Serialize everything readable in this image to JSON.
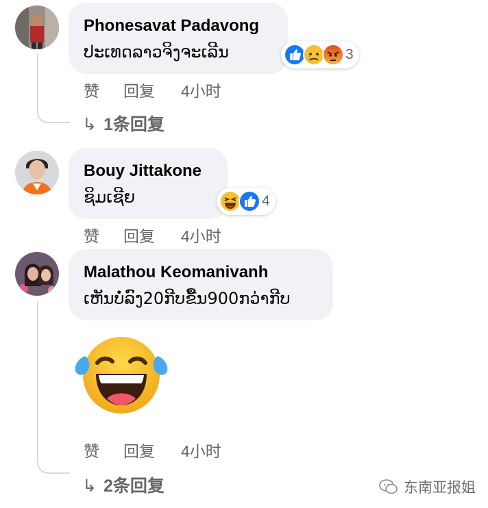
{
  "comments": [
    {
      "author": "Phonesavat Padavong",
      "text": "ປະເທດລາວຈິງຈະເລີນ",
      "reaction_icons": [
        "like-icon",
        "sad-icon",
        "angry-icon"
      ],
      "reaction_count": "3",
      "actions": {
        "like": "赞",
        "reply": "回复",
        "time": "4小时"
      },
      "replies_label": "1条回复"
    },
    {
      "author": "Bouy Jittakone",
      "text": "ຊິມເຊີຍ",
      "reaction_icons": [
        "haha-icon",
        "like-icon"
      ],
      "reaction_count": "4",
      "actions": {
        "like": "赞",
        "reply": "回复",
        "time": "4小时"
      }
    },
    {
      "author": "Malathou Keomanivanh",
      "text": "ເຫັນບໍ່ລົງ20ກີບຂື້ນ900ກວ່າກີບ",
      "sticker": "tears-of-joy-emoji",
      "actions": {
        "like": "赞",
        "reply": "回复",
        "time": "4小时"
      },
      "replies_label": "2条回复"
    }
  ],
  "watermark": "东南亚报姐",
  "colors": {
    "bubble": "#f0f2f5",
    "meta_text": "#65676b",
    "like_blue": "#1877f2",
    "emoji_yellow": "#f7c033",
    "angry_orange": "#e9710f"
  }
}
